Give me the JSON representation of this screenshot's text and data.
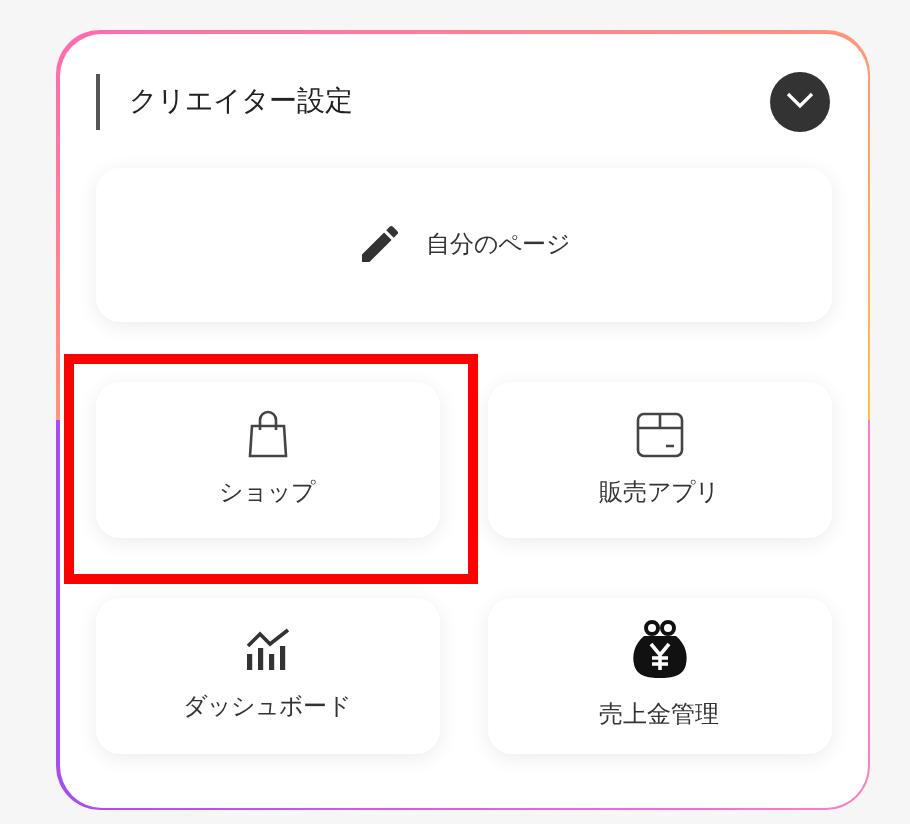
{
  "section": {
    "title": "クリエイター設定",
    "expanded": true
  },
  "wide_tile": {
    "kind": "pencil",
    "label": "自分のページ"
  },
  "tiles": [
    {
      "kind": "bag",
      "label": "ショップ",
      "highlighted": true
    },
    {
      "kind": "box",
      "label": "販売アプリ",
      "highlighted": false
    },
    {
      "kind": "chart",
      "label": "ダッシュボード",
      "highlighted": false
    },
    {
      "kind": "purse",
      "label": "売上金管理",
      "highlighted": false
    }
  ]
}
